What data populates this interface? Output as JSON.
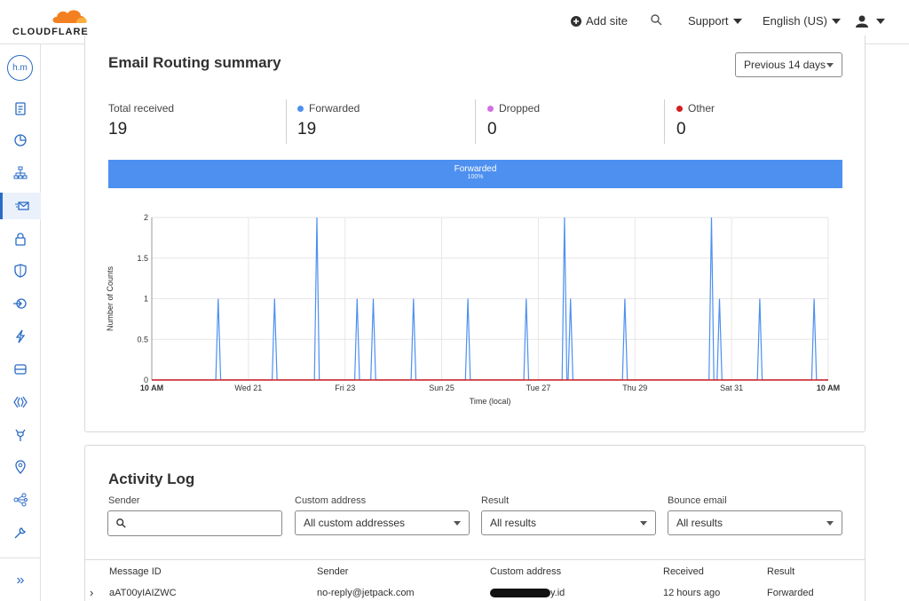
{
  "topbar": {
    "logo_text": "CLOUDFLARE",
    "add_site": "Add site",
    "support": "Support",
    "language": "English (US)"
  },
  "sidebar": {
    "avatar_initials": "h.m",
    "expand": "»",
    "items": [
      "overview-icon",
      "analytics-icon",
      "dns-icon",
      "email-icon",
      "ssl-icon",
      "security-icon",
      "access-icon",
      "speed-icon",
      "caching-icon",
      "workers-icon",
      "rules-icon",
      "network-icon",
      "traffic-icon",
      "custom-pages-icon"
    ]
  },
  "summary": {
    "title": "Email Routing summary",
    "range": "Previous 14 days",
    "stats": [
      {
        "label": "Total received",
        "value": "19",
        "color": ""
      },
      {
        "label": "Forwarded",
        "value": "19",
        "color": "#4d90f0"
      },
      {
        "label": "Dropped",
        "value": "0",
        "color": "#d070e0"
      },
      {
        "label": "Other",
        "value": "0",
        "color": "#d22020"
      }
    ],
    "bar_label": "Forwarded",
    "bar_pct": "100%",
    "bar_fraction": 1.0
  },
  "chart_data": {
    "type": "line",
    "title": "",
    "xlabel": "Time (local)",
    "ylabel": "Number of Counts",
    "ylim": [
      0,
      2
    ],
    "yticks": [
      "0",
      "0.5",
      "1",
      "1.5",
      "2"
    ],
    "xticks": [
      "10 AM",
      "Wed 21",
      "Fri 23",
      "Sun 25",
      "Tue 27",
      "Thu 29",
      "Sat 31",
      "10 AM"
    ],
    "xlim_hours": [
      0,
      336
    ],
    "grid": true,
    "series": [
      {
        "color": "#4d90f0",
        "peaks_hours": [
          [
            33,
            1
          ],
          [
            61,
            1
          ],
          [
            82,
            2
          ],
          [
            102,
            1
          ],
          [
            110,
            1
          ],
          [
            130,
            1
          ],
          [
            157,
            1
          ],
          [
            186,
            1
          ],
          [
            205,
            2
          ],
          [
            208,
            1
          ],
          [
            235,
            1
          ],
          [
            278,
            2
          ],
          [
            282,
            1
          ],
          [
            302,
            1
          ],
          [
            329,
            1
          ]
        ]
      },
      {
        "color": "#d22020",
        "flat": 0
      }
    ]
  },
  "activity": {
    "title": "Activity Log",
    "filters": [
      {
        "label": "Sender",
        "value": ""
      },
      {
        "label": "Custom address",
        "value": "All custom addresses"
      },
      {
        "label": "Result",
        "value": "All results"
      },
      {
        "label": "Bounce email",
        "value": "All results"
      }
    ],
    "columns": [
      "Message ID",
      "Sender",
      "Custom address",
      "Received",
      "Result"
    ],
    "rows": [
      {
        "id": "aAT00yIAIZWC",
        "sender": "no-reply@jetpack.com",
        "address": "y.id",
        "received": "12 hours ago",
        "result": "Forwarded"
      }
    ]
  }
}
